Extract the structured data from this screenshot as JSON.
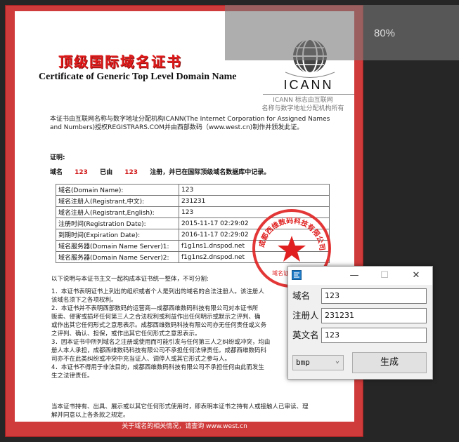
{
  "viewer": {
    "zoom_level": "80%"
  },
  "certificate": {
    "title": "顶级国际域名证书",
    "subtitle": "Certificate of Generic Top Level Domain Name",
    "icann_word": "ICANN",
    "icann_note_1": "ICANN 标志由互联网",
    "icann_note_2": "名称与数字地址分配机构所有",
    "intro": "本证书由互联网名称与数字地址分配机构ICANN(The Internet Corporation for Assigned Names and Numbers)授权REGISTRARS.COM并由西部数码（www.west.cn)制作并颁发此证。",
    "proof_label": "证明:",
    "claim": {
      "domain_label": "域名",
      "domain_value": "123",
      "by_label": "已由",
      "by_value": "123",
      "suffix": "注册，并已在国际顶级域名数据库中记录。"
    },
    "table": [
      {
        "key": "域名(Domain Name):",
        "value": "123"
      },
      {
        "key": "域名注册人(Registrant,中文):",
        "value": "231231"
      },
      {
        "key": "域名注册人(Registrant,English):",
        "value": "123"
      },
      {
        "key": "注册时间(Registration Date):",
        "value": "2015-11-17 02:29:02"
      },
      {
        "key": "到期时间(Expiration Date):",
        "value": "2016-11-17 02:29:02"
      },
      {
        "key": "域名服务器(Domain Name Server)1:",
        "value": "f1g1ns1.dnspod.net"
      },
      {
        "key": "域名服务器(Domain Name Server)2:",
        "value": "f1g1ns2.dnspod.net"
      }
    ],
    "terms_intro": "以下说明与本证书主文一起构成本证书统一整体，不可分割:",
    "terms": [
      "1．本证书表明证书上列出的组织或者个人是列出的域名的合法注册人。该注册人",
      "该域名须下之各项权利。",
      "2．本证书并不表明西部数码的运营商—成都西维数码科技有限公司对本证书所",
      "贩卖、侵害或损坏任何第三人之合法权利或利益作出任何明示或默示之评判、确",
      "或作出其它任何形式之意思表示。成都西维数码科技有限公司亦无任何责任或义务",
      "之评判、确认、担保，或作出其它任何形式之意思表示。",
      "3．因本证书中所列域名之注册或使用而可能引发与任何第三人之纠纷或冲突，均由",
      "册人本人承担，成都西维数码科技有限公司不承担任何法律责任。成都西维数码科",
      "司亦不在此类纠纷或冲突中充当证人、调停人或其它形式之参与人。",
      "4．本证书不得用于非法目的，成都西维数码科技有限公司不承担任何由此而发生",
      "生之法律责任。"
    ],
    "footer_note": "当本证书持有、出具、展示或以其它任何形式使用时，即表明本证书之持有人或接触人已审读、理解并同意以上各条款之规定。",
    "bottom_bar": "关于域名的相关情况，请查询 www.west.cn",
    "stamp_top": "成都西维数码科技有限公司",
    "stamp_bottom": "域名证书专用章"
  },
  "dialog": {
    "minimize": "—",
    "maximize": "☐",
    "close": "✕",
    "fields": [
      {
        "label": "域名",
        "value": "123"
      },
      {
        "label": "注册人",
        "value": "231231"
      },
      {
        "label": "英文名",
        "value": "123"
      }
    ],
    "format_selected": "bmp",
    "generate_label": "生成"
  }
}
